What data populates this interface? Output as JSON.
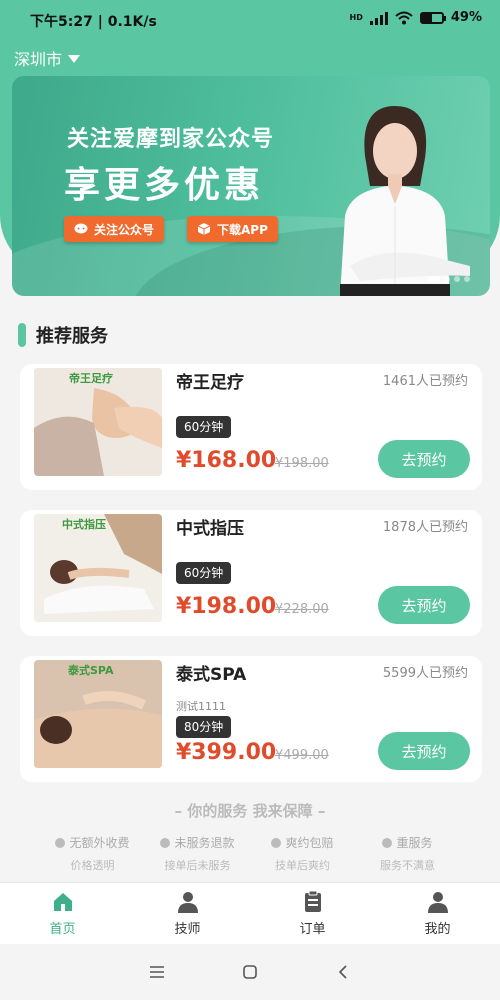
{
  "status": {
    "time": "下午5:27",
    "speed": "0.1K/s",
    "network": "HD",
    "battery": "49%",
    "battery_level": 0.49
  },
  "city": {
    "name": "深圳市"
  },
  "banner": {
    "line1": "关注爱摩到家公众号",
    "line2": "享更多优惠",
    "follow_btn": "关注公众号",
    "download_btn": "下载APP",
    "slide_count": 4,
    "active_slide": 0
  },
  "section": {
    "title": "推荐服务"
  },
  "services": [
    {
      "name": "帝王足疗",
      "booked": "1461人已预约",
      "subtitle": "",
      "duration": "60分钟",
      "price": "¥168.00",
      "original": "¥198.00",
      "button": "去预约",
      "image_label": "帝王足疗"
    },
    {
      "name": "中式指压",
      "booked": "1878人已预约",
      "subtitle": "",
      "duration": "60分钟",
      "price": "¥198.00",
      "original": "¥228.00",
      "button": "去预约",
      "image_label": "中式指压"
    },
    {
      "name": "泰式SPA",
      "booked": "5599人已预约",
      "subtitle": "测试1111",
      "duration": "80分钟",
      "price": "¥399.00",
      "original": "¥499.00",
      "button": "去预约",
      "image_label": "泰式SPA"
    }
  ],
  "guarantee": {
    "title": "– 你的服务 我来保障 –",
    "items": [
      {
        "title": "无额外收费",
        "sub": "价格透明"
      },
      {
        "title": "未服务退款",
        "sub": "接单后未服务"
      },
      {
        "title": "爽约包赔",
        "sub": "技单后爽约"
      },
      {
        "title": "重服务",
        "sub": "服务不满意"
      }
    ]
  },
  "tabs": [
    {
      "label": "首页",
      "icon": "home-icon",
      "active": true
    },
    {
      "label": "技师",
      "icon": "technician-icon",
      "active": false
    },
    {
      "label": "订单",
      "icon": "order-icon",
      "active": false
    },
    {
      "label": "我的",
      "icon": "profile-icon",
      "active": false
    }
  ],
  "colors": {
    "brand": "#5bc6a2",
    "price": "#e04b2b",
    "banner_button": "#f06a2e"
  }
}
